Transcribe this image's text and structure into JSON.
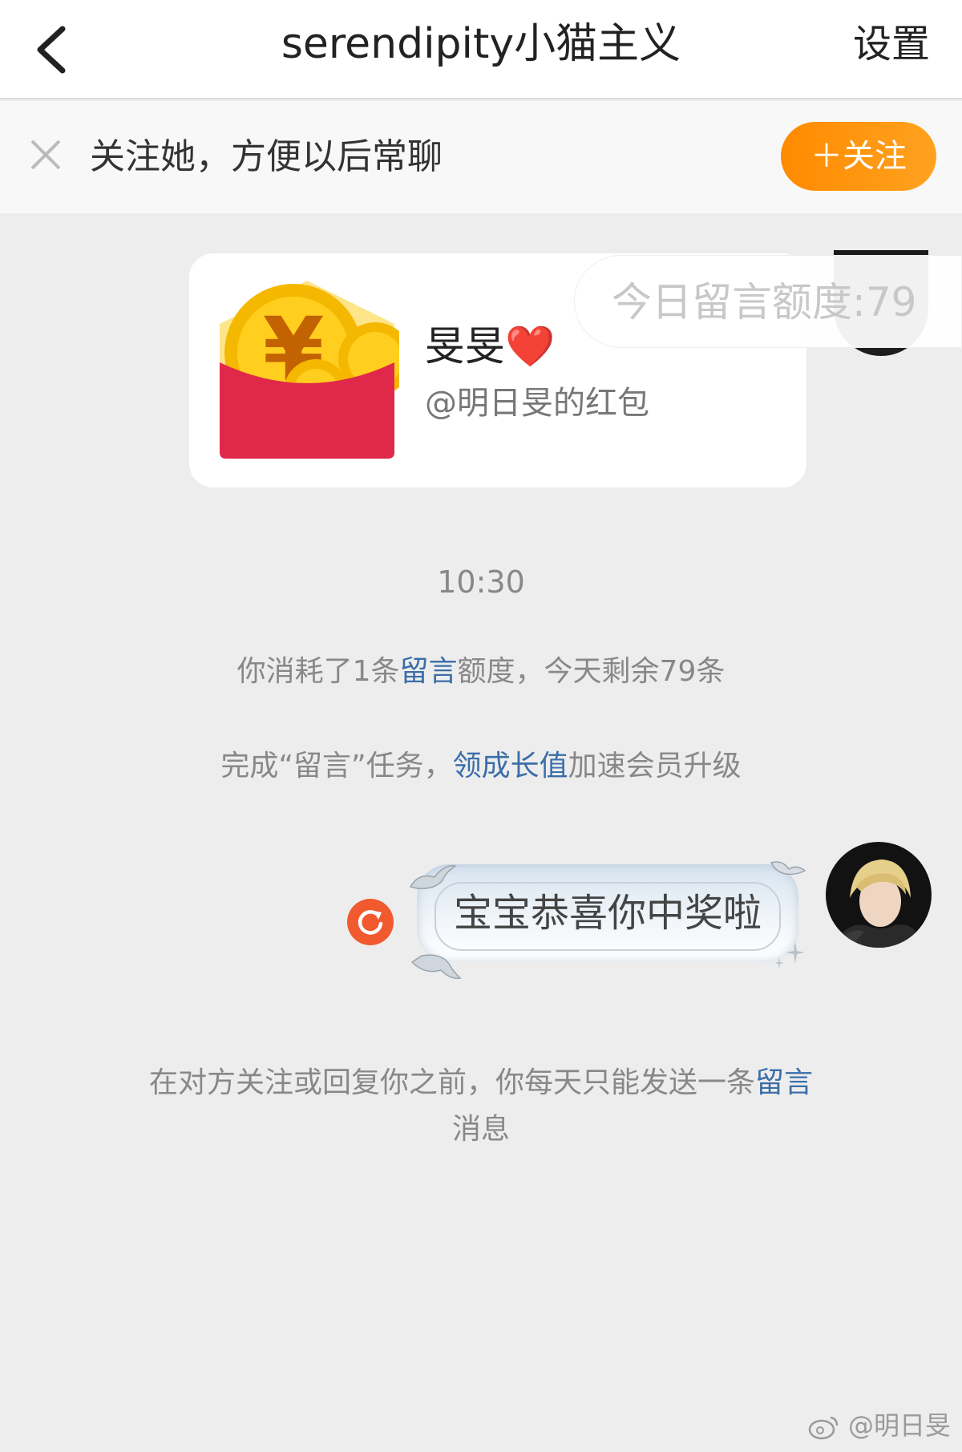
{
  "header": {
    "title": "serendipity小猫主义",
    "settings_label": "设置"
  },
  "follow_bar": {
    "text": "关注她，方便以后常聊",
    "button_label": "＋关注"
  },
  "red_packet": {
    "title": "旻旻❤️",
    "subtitle": "@明日旻的红包"
  },
  "quota_pill": "今日留言额度:79",
  "chat": {
    "time": "10:30",
    "consume_prefix": "你消耗了1条",
    "consume_link": "留言",
    "consume_suffix": "额度，今天剩余79条",
    "task_prefix": "完成“留言”任务，",
    "task_link": "领成长值",
    "task_suffix": "加速会员升级",
    "message_text": "宝宝恭喜你中奖啦",
    "notice_prefix": "在对方关注或回复你之前，你每天只能发送一条",
    "notice_link": "留言",
    "notice_suffix": "消息"
  },
  "watermark": "@明日旻",
  "colors": {
    "accent_orange": "#ff8a00",
    "link_blue": "#3b6ea8",
    "retry_red": "#f05a2e"
  }
}
